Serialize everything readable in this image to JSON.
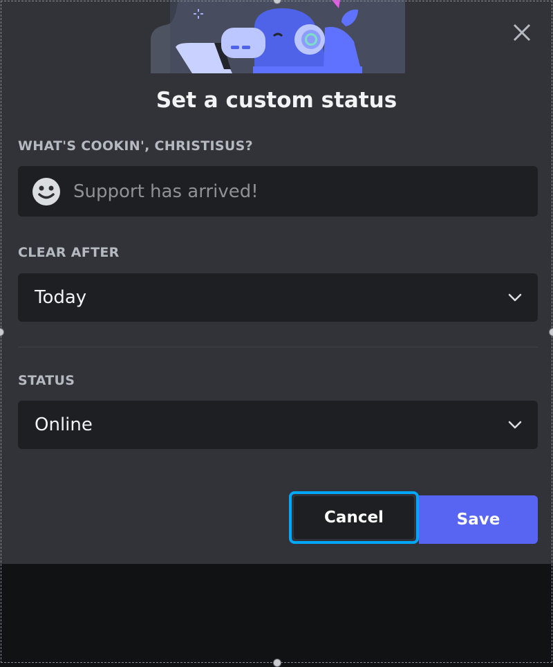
{
  "dialog": {
    "title": "Set a custom status",
    "status_label": "WHAT'S COOKIN', CHRISTISUS?",
    "status_placeholder": "Support has arrived!",
    "clear_after_label": "CLEAR AFTER",
    "clear_after_value": "Today",
    "status_section_label": "STATUS",
    "status_value": "Online"
  },
  "buttons": {
    "cancel": "Cancel",
    "save": "Save"
  },
  "icons": {
    "close": "close-icon",
    "emoji": "smiley-face-icon",
    "chevron": "chevron-down-icon"
  },
  "colors": {
    "modal_background": "#313338",
    "field_background": "#1e1f22",
    "accent": "#5865f2",
    "focus_ring": "#00a8fc"
  }
}
